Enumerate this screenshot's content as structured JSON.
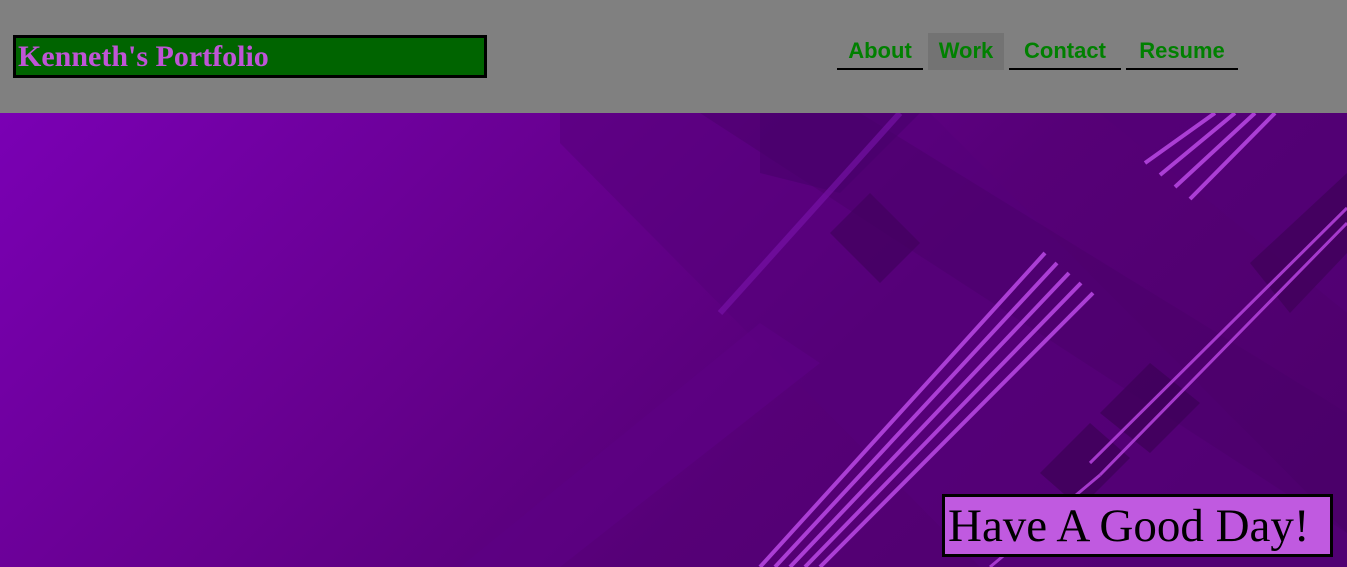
{
  "header": {
    "logo_text": "Kenneth's Portfolio"
  },
  "nav": {
    "items": [
      {
        "label": "About",
        "active": false
      },
      {
        "label": "Work",
        "active": true
      },
      {
        "label": "Contact",
        "active": false
      },
      {
        "label": "Resume",
        "active": false
      }
    ]
  },
  "hero": {
    "background": "purple-geometric-stripes",
    "greeting": "Have A Good Day!"
  },
  "colors": {
    "header_bg": "#808080",
    "logo_bg": "#006400",
    "logo_text": "#bf55d6",
    "nav_text": "#008000",
    "nav_active_bg": "#737373",
    "hero_purple": "#6a009a",
    "greeting_bg": "#c05ae0"
  }
}
